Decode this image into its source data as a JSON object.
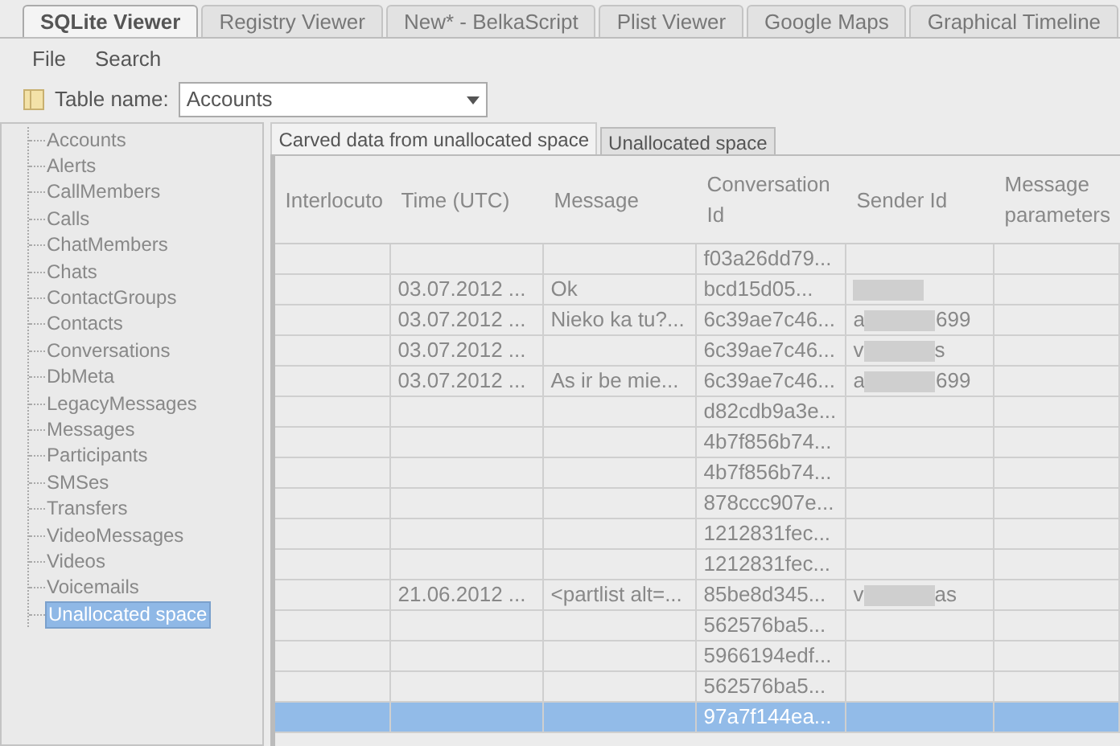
{
  "app_tabs": [
    {
      "label": "SQLite Viewer",
      "selected": true
    },
    {
      "label": "Registry Viewer",
      "selected": false
    },
    {
      "label": "New* - BelkaScript",
      "selected": false
    },
    {
      "label": "Plist Viewer",
      "selected": false
    },
    {
      "label": "Google Maps",
      "selected": false
    },
    {
      "label": "Graphical Timeline",
      "selected": false
    }
  ],
  "menu": [
    "File",
    "Search"
  ],
  "toolbar": {
    "label": "Table name:",
    "value": "Accounts"
  },
  "tables": [
    {
      "label": "Accounts",
      "selected": false
    },
    {
      "label": "Alerts",
      "selected": false
    },
    {
      "label": "CallMembers",
      "selected": false
    },
    {
      "label": "Calls",
      "selected": false
    },
    {
      "label": "ChatMembers",
      "selected": false
    },
    {
      "label": "Chats",
      "selected": false
    },
    {
      "label": "ContactGroups",
      "selected": false
    },
    {
      "label": "Contacts",
      "selected": false
    },
    {
      "label": "Conversations",
      "selected": false
    },
    {
      "label": "DbMeta",
      "selected": false
    },
    {
      "label": "LegacyMessages",
      "selected": false
    },
    {
      "label": "Messages",
      "selected": false
    },
    {
      "label": "Participants",
      "selected": false
    },
    {
      "label": "SMSes",
      "selected": false
    },
    {
      "label": "Transfers",
      "selected": false
    },
    {
      "label": "VideoMessages",
      "selected": false
    },
    {
      "label": "Videos",
      "selected": false
    },
    {
      "label": "Voicemails",
      "selected": false
    },
    {
      "label": "Unallocated space",
      "selected": true
    }
  ],
  "view_tabs": [
    {
      "label": "Carved data from unallocated space",
      "selected": true
    },
    {
      "label": "Unallocated space",
      "selected": false
    }
  ],
  "table": {
    "columns": [
      "Interlocuto",
      "Time (UTC)",
      "Message",
      "Conversation Id",
      "Sender Id",
      "Message parameters"
    ],
    "rows": [
      {
        "selected": false,
        "cells": [
          "",
          "",
          "",
          "f03a26dd79...",
          null,
          ""
        ]
      },
      {
        "selected": false,
        "cells": [
          "",
          "03.07.2012 ...",
          "Ok",
          "bcd15d05...",
          {
            "redacted": true
          },
          ""
        ]
      },
      {
        "selected": false,
        "cells": [
          "",
          "03.07.2012 ...",
          "Nieko ka tu?...",
          "6c39ae7c46...",
          {
            "prefix": "a",
            "suffix": "699"
          },
          ""
        ]
      },
      {
        "selected": false,
        "cells": [
          "",
          "03.07.2012 ...",
          "",
          "6c39ae7c46...",
          {
            "prefix": "v",
            "suffix": "s"
          },
          ""
        ]
      },
      {
        "selected": false,
        "cells": [
          "",
          "03.07.2012 ...",
          "As ir be mie...",
          "6c39ae7c46...",
          {
            "prefix": "a",
            "suffix": "699"
          },
          ""
        ]
      },
      {
        "selected": false,
        "cells": [
          "",
          "",
          "",
          "d82cdb9a3e...",
          null,
          ""
        ]
      },
      {
        "selected": false,
        "cells": [
          "",
          "",
          "",
          "4b7f856b74...",
          null,
          ""
        ]
      },
      {
        "selected": false,
        "cells": [
          "",
          "",
          "",
          "4b7f856b74...",
          null,
          ""
        ]
      },
      {
        "selected": false,
        "cells": [
          "",
          "",
          "",
          "878ccc907e...",
          null,
          ""
        ]
      },
      {
        "selected": false,
        "cells": [
          "",
          "",
          "",
          "1212831fec...",
          null,
          ""
        ]
      },
      {
        "selected": false,
        "cells": [
          "",
          "",
          "",
          "1212831fec...",
          null,
          ""
        ]
      },
      {
        "selected": false,
        "cells": [
          "",
          "21.06.2012 ...",
          "<partlist alt=...",
          "85be8d345...",
          {
            "prefix": "v",
            "suffix": "as"
          },
          ""
        ]
      },
      {
        "selected": false,
        "cells": [
          "",
          "",
          "",
          "562576ba5...",
          null,
          ""
        ]
      },
      {
        "selected": false,
        "cells": [
          "",
          "",
          "",
          "5966194edf...",
          null,
          ""
        ]
      },
      {
        "selected": false,
        "cells": [
          "",
          "",
          "",
          "562576ba5...",
          null,
          ""
        ]
      },
      {
        "selected": true,
        "cells": [
          "",
          "",
          "",
          "97a7f144ea...",
          null,
          ""
        ]
      }
    ]
  }
}
